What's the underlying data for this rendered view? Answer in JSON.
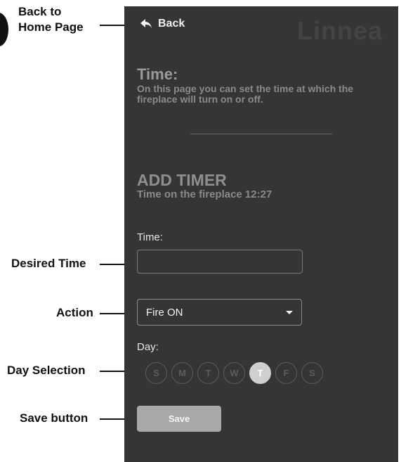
{
  "annotations": {
    "back": "Back to\nHome Page",
    "desired_time": "Desired Time",
    "action": "Action",
    "day_selection": "Day Selection",
    "save_button": "Save button"
  },
  "header": {
    "back_label": "Back",
    "brand": "Linnea"
  },
  "section": {
    "title": "Time:",
    "description": "On this page you can set the time at which the fireplace will turn on or off."
  },
  "add_timer": {
    "title": "ADD TIMER",
    "subtitle": "Time on the fireplace 12:27"
  },
  "form": {
    "time_label": "Time:",
    "time_value": "",
    "action_value": "Fire ON",
    "day_label": "Day:",
    "days": [
      {
        "label": "S",
        "active": false
      },
      {
        "label": "M",
        "active": false
      },
      {
        "label": "T",
        "active": false
      },
      {
        "label": "W",
        "active": false
      },
      {
        "label": "T",
        "active": true
      },
      {
        "label": "F",
        "active": false
      },
      {
        "label": "S",
        "active": false
      }
    ],
    "save_label": "Save"
  },
  "colors": {
    "panel_bg": "#353535",
    "active_day": "#cfcfcf",
    "save_bg": "#a8a8a8"
  },
  "icons": {
    "back": "back-arrow-icon",
    "dropdown": "chevron-down-icon"
  }
}
